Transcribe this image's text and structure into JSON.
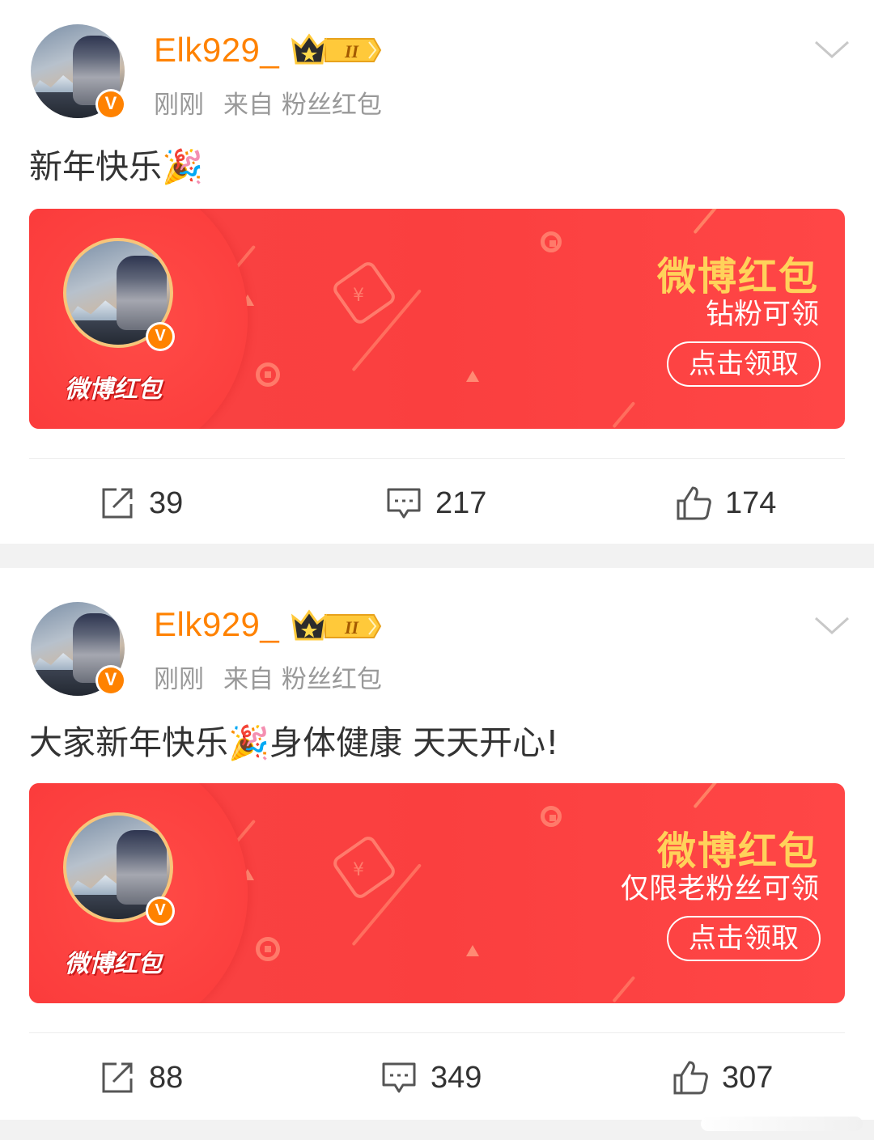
{
  "posts": [
    {
      "username": "Elk929_",
      "time": "刚刚",
      "source": "来自 粉丝红包",
      "text": "新年快乐🎉",
      "card": {
        "logo": "微博红包",
        "title": "微博红包",
        "subtitle": "钻粉可领",
        "button": "点击领取"
      },
      "stats": {
        "reposts": "39",
        "comments": "217",
        "likes": "174"
      }
    },
    {
      "username": "Elk929_",
      "time": "刚刚",
      "source": "来自 粉丝红包",
      "text": "大家新年快乐🎉身体健康 天天开心!",
      "card": {
        "logo": "微博红包",
        "title": "微博红包",
        "subtitle": "仅限老粉丝可领",
        "button": "点击领取"
      },
      "stats": {
        "reposts": "88",
        "comments": "349",
        "likes": "307"
      }
    }
  ],
  "icons": {
    "verified": "verified-v-icon",
    "vip": "crown-level-icon",
    "menu": "chevron-down-icon",
    "repost": "repost-icon",
    "comment": "comment-icon",
    "like": "thumbs-up-icon"
  },
  "colors": {
    "username": "#ff8200",
    "card_red": "#fa3f3f",
    "card_title": "#ffd25a",
    "meta": "#999999"
  }
}
